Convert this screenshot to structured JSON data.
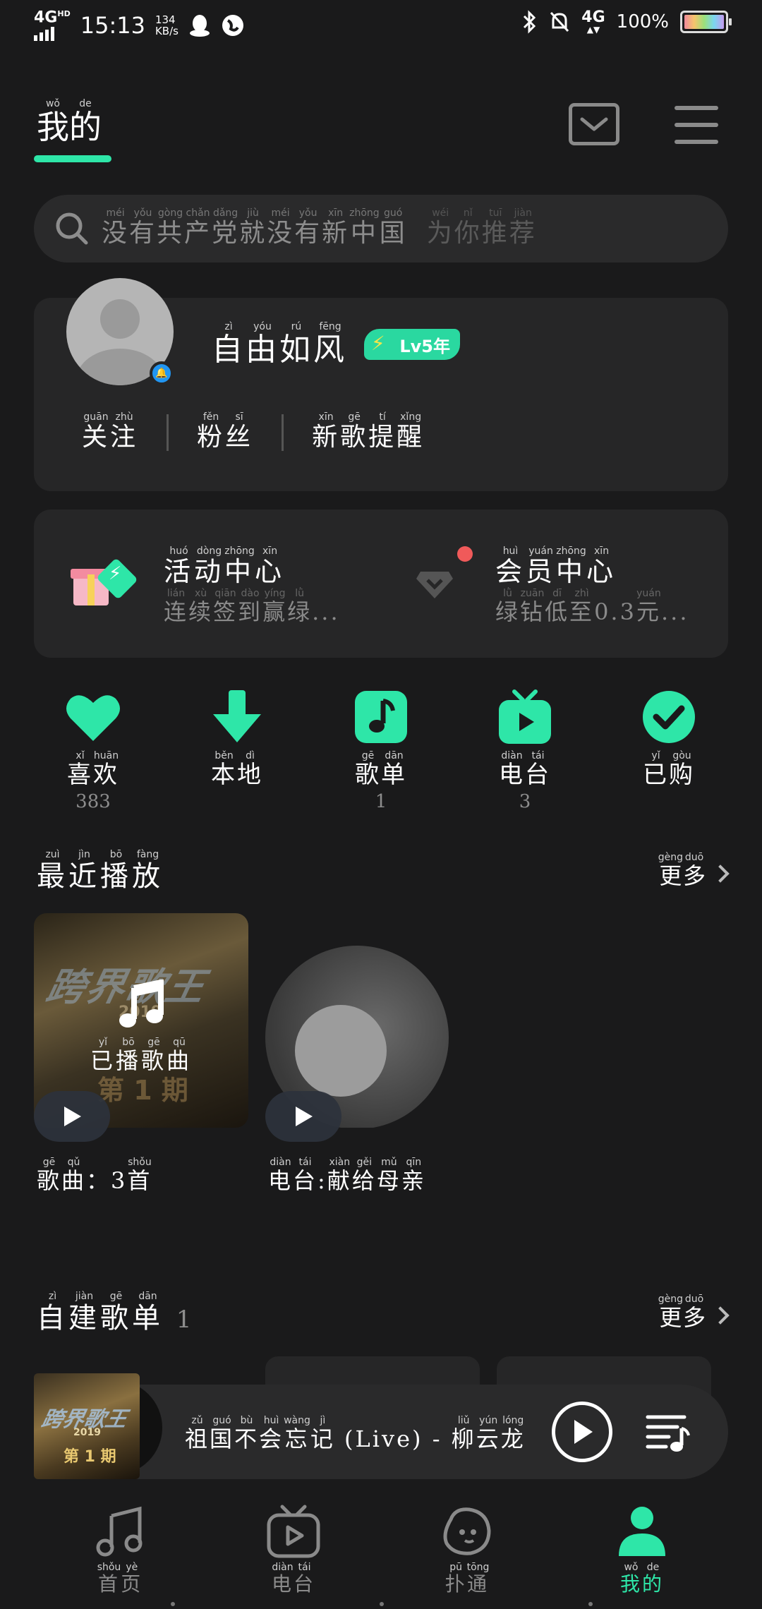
{
  "status_bar": {
    "network": "4G",
    "network_sup": "HD",
    "time": "15:13",
    "speed_value": "134",
    "speed_unit": "KB/s",
    "mobile_data": "4G",
    "battery": "100%"
  },
  "header": {
    "tab_label": "我的",
    "tab_pinyin": [
      "wǒ",
      "de"
    ]
  },
  "search": {
    "query": [
      "没",
      "有",
      "共",
      "产",
      "党",
      "就",
      "没",
      "有",
      "新",
      "中",
      "国"
    ],
    "query_pinyin": [
      "méi",
      "yǒu",
      "gòng",
      "chǎn",
      "dǎng",
      "jiù",
      "méi",
      "yǒu",
      "xīn",
      "zhōng",
      "guó"
    ],
    "hint": [
      "为",
      "你",
      "推",
      "荐"
    ],
    "hint_pinyin": [
      "wéi",
      "nǐ",
      "tuī",
      "jiàn"
    ]
  },
  "profile": {
    "username": [
      "自",
      "由",
      "如",
      "风"
    ],
    "username_pinyin": [
      "zì",
      "yóu",
      "rú",
      "fēng"
    ],
    "vip_badge": "Lv5年",
    "stats": [
      {
        "label": [
          "关",
          "注"
        ],
        "pinyin": [
          "guān",
          "zhù"
        ]
      },
      {
        "label": [
          "粉",
          "丝"
        ],
        "pinyin": [
          "fěn",
          "sī"
        ]
      },
      {
        "label": [
          "新",
          "歌",
          "提",
          "醒"
        ],
        "pinyin": [
          "xīn",
          "gē",
          "tí",
          "xǐng"
        ]
      }
    ]
  },
  "activity": {
    "left_title": [
      "活",
      "动",
      "中",
      "心"
    ],
    "left_title_pinyin": [
      "huó",
      "dòng",
      "zhōng",
      "xīn"
    ],
    "left_sub": [
      "连",
      "续",
      "签",
      "到",
      "赢",
      "绿",
      "..."
    ],
    "left_sub_pinyin": [
      "lián",
      "xù",
      "qiān",
      "dào",
      "yíng",
      "lǜ",
      ""
    ],
    "right_title": [
      "会",
      "员",
      "中",
      "心"
    ],
    "right_title_pinyin": [
      "huì",
      "yuán",
      "zhōng",
      "xīn"
    ],
    "right_sub": [
      "绿",
      "钻",
      "低",
      "至",
      "0.3",
      "元",
      "..."
    ],
    "right_sub_pinyin": [
      "lǜ",
      "zuān",
      "dī",
      "zhì",
      "",
      "yuán",
      ""
    ]
  },
  "shortcuts": [
    {
      "label": [
        "喜",
        "欢"
      ],
      "pinyin": [
        "xǐ",
        "huān"
      ],
      "count": "383",
      "icon": "heart-icon"
    },
    {
      "label": [
        "本",
        "地"
      ],
      "pinyin": [
        "běn",
        "dì"
      ],
      "count": "",
      "icon": "download-icon"
    },
    {
      "label": [
        "歌",
        "单"
      ],
      "pinyin": [
        "gē",
        "dān"
      ],
      "count": "1",
      "icon": "playlist-icon"
    },
    {
      "label": [
        "电",
        "台"
      ],
      "pinyin": [
        "diàn",
        "tái"
      ],
      "count": "3",
      "icon": "radio-tv-icon"
    },
    {
      "label": [
        "已",
        "购"
      ],
      "pinyin": [
        "yǐ",
        "gòu"
      ],
      "count": "",
      "icon": "check-circle-icon"
    }
  ],
  "recent": {
    "title": [
      "最",
      "近",
      "播",
      "放"
    ],
    "title_pinyin": [
      "zuì",
      "jìn",
      "bō",
      "fàng"
    ],
    "more": [
      "更",
      "多"
    ],
    "more_pinyin": [
      "gèng",
      "duō"
    ],
    "card1_cover_label": [
      "已",
      "播",
      "歌",
      "曲"
    ],
    "card1_cover_label_pinyin": [
      "yǐ",
      "bō",
      "gē",
      "qū"
    ],
    "card1_caption": [
      "歌",
      "曲",
      "：3",
      "首"
    ],
    "card1_caption_pinyin": [
      "gē",
      "qǔ",
      "",
      "shǒu"
    ],
    "card2_caption": [
      "电",
      "台",
      ":",
      "献",
      "给",
      "母",
      "亲"
    ],
    "card2_caption_pinyin": [
      "diàn",
      "tái",
      "",
      "xiàn",
      "gěi",
      "mǔ",
      "qīn"
    ]
  },
  "my_playlists": {
    "title": [
      "自",
      "建",
      "歌",
      "单"
    ],
    "title_pinyin": [
      "zì",
      "jiàn",
      "gē",
      "dān"
    ],
    "count": "1",
    "more": [
      "更",
      "多"
    ],
    "more_pinyin": [
      "gèng",
      "duō"
    ]
  },
  "player": {
    "song": [
      "祖",
      "国",
      "不",
      "会",
      "忘",
      "记"
    ],
    "song_pinyin": [
      "zǔ",
      "guó",
      "bù",
      "huì",
      "wàng",
      "jì"
    ],
    "suffix": "(Live) -",
    "artist": [
      "柳",
      "云",
      "龙"
    ],
    "artist_pinyin": [
      "liǔ",
      "yún",
      "lóng"
    ]
  },
  "nav": [
    {
      "label": [
        "首",
        "页"
      ],
      "pinyin": [
        "shǒu",
        "yè"
      ],
      "icon": "music-note-icon"
    },
    {
      "label": [
        "电",
        "台"
      ],
      "pinyin": [
        "diàn",
        "tái"
      ],
      "icon": "radio-tv-icon"
    },
    {
      "label": [
        "扑",
        "通"
      ],
      "pinyin": [
        "pū",
        "tōng"
      ],
      "icon": "face-bubble-icon"
    },
    {
      "label": [
        "我",
        "的"
      ],
      "pinyin": [
        "wǒ",
        "de"
      ],
      "icon": "person-icon"
    }
  ],
  "colors": {
    "accent": "#2ee6a8",
    "background": "#1a1a1b",
    "card": "#262627"
  }
}
